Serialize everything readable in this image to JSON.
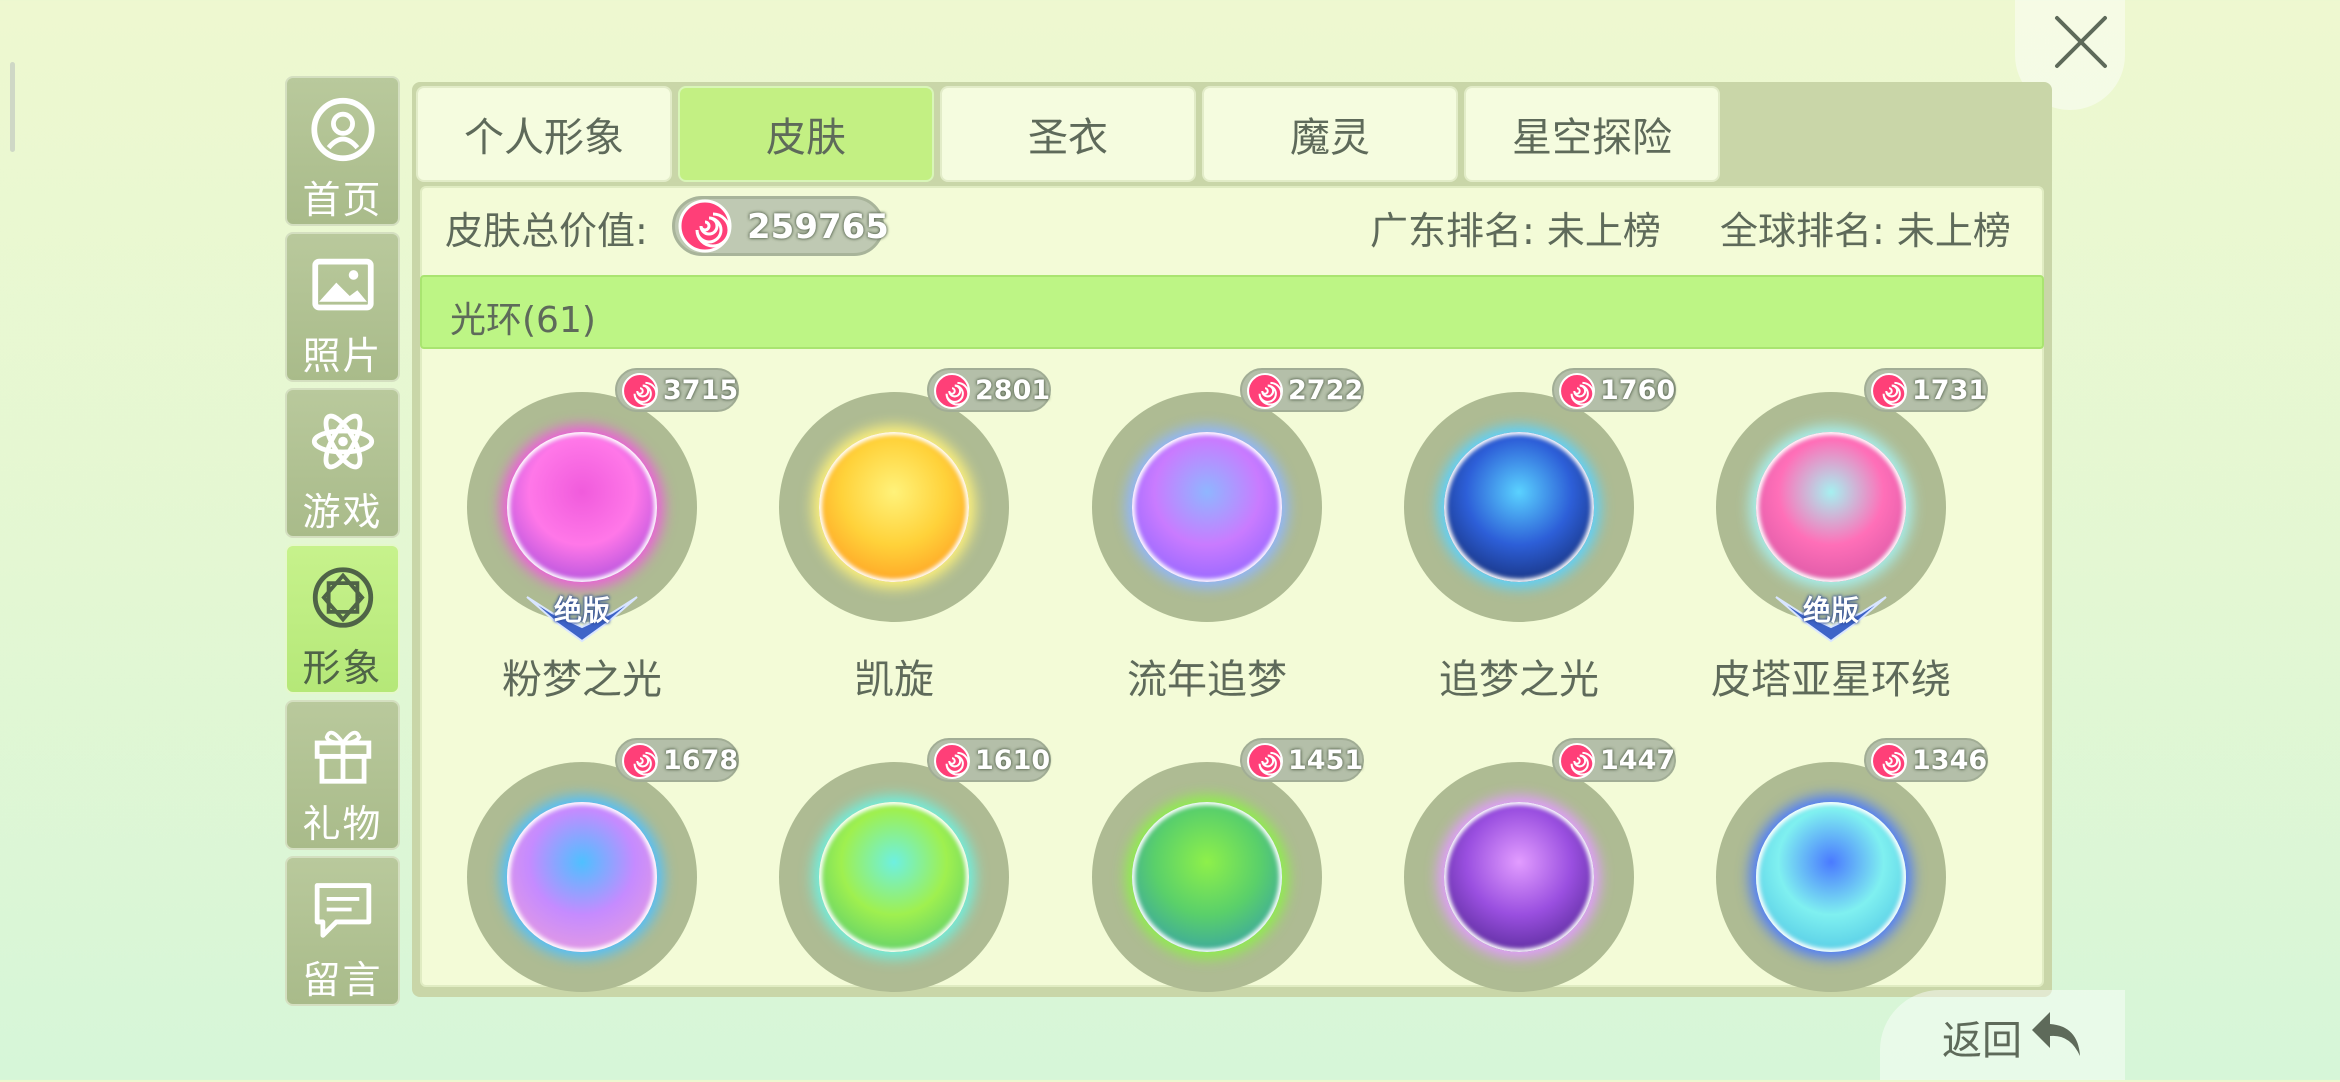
{
  "sidebar": {
    "items": [
      {
        "label": "首页",
        "icon": "profile-icon"
      },
      {
        "label": "照片",
        "icon": "photo-icon"
      },
      {
        "label": "游戏",
        "icon": "atom-icon"
      },
      {
        "label": "形象",
        "icon": "diamond-icon",
        "active": true
      },
      {
        "label": "礼物",
        "icon": "gift-icon"
      },
      {
        "label": "留言",
        "icon": "message-icon"
      }
    ]
  },
  "tabs": [
    {
      "label": "个人形象"
    },
    {
      "label": "皮肤",
      "active": true
    },
    {
      "label": "圣衣"
    },
    {
      "label": "魔灵"
    },
    {
      "label": "星空探险"
    }
  ],
  "summary": {
    "total_label": "皮肤总价值:",
    "total_value": "259765",
    "guangdong_rank": "广东排名: 未上榜",
    "global_rank": "全球排名: 未上榜"
  },
  "category": {
    "label": "光环(61)"
  },
  "items": [
    {
      "name": "粉梦之光",
      "price": "3715",
      "badge": "绝版",
      "colors": [
        "#ff77e8",
        "#8a3fd8",
        "#f05bdc"
      ]
    },
    {
      "name": "凯旋",
      "price": "2801",
      "badge": "",
      "colors": [
        "#ffd23a",
        "#ff8a1a",
        "#fff27a"
      ]
    },
    {
      "name": "流年追梦",
      "price": "2722",
      "badge": "",
      "colors": [
        "#c97bff",
        "#7a5cff",
        "#8fb6ff"
      ]
    },
    {
      "name": "追梦之光",
      "price": "1760",
      "badge": "",
      "colors": [
        "#2d5fd8",
        "#0c1a4d",
        "#5ad2ff"
      ]
    },
    {
      "name": "皮塔亚星环绕",
      "price": "1731",
      "badge": "绝版",
      "colors": [
        "#ff6fb8",
        "#c94e9e",
        "#a6f0f0"
      ]
    },
    {
      "name": "",
      "price": "1678",
      "badge": "",
      "colors": [
        "#c58bff",
        "#f5a2d2",
        "#4fc0ff"
      ]
    },
    {
      "name": "",
      "price": "1610",
      "badge": "",
      "colors": [
        "#9ff04f",
        "#3fbf7a",
        "#6ef0e0"
      ]
    },
    {
      "name": "",
      "price": "1451",
      "badge": "",
      "colors": [
        "#5ad06a",
        "#2a8fbf",
        "#8ef04a"
      ]
    },
    {
      "name": "",
      "price": "1447",
      "badge": "",
      "colors": [
        "#9a4fe0",
        "#3a1a78",
        "#e29cff"
      ]
    },
    {
      "name": "",
      "price": "1346",
      "badge": "",
      "colors": [
        "#7ff0f0",
        "#3fb6e0",
        "#4a7aff"
      ]
    }
  ],
  "back": {
    "label": "返回"
  }
}
